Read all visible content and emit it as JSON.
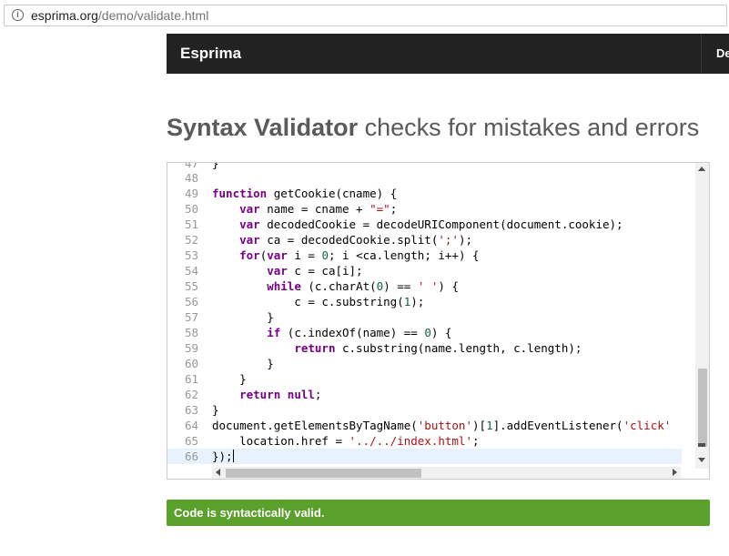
{
  "browser": {
    "url_host": "esprima.org",
    "url_path": "/demo/validate.html"
  },
  "navbar": {
    "brand": "Esprima",
    "link_partial": "De"
  },
  "heading": {
    "bold": "Syntax Validator",
    "rest": " checks for mistakes and errors"
  },
  "editor": {
    "partial_line_number": "47",
    "partial_line_code": "}",
    "line_numbers": [
      "48",
      "49",
      "50",
      "51",
      "52",
      "53",
      "54",
      "55",
      "56",
      "57",
      "58",
      "59",
      "60",
      "61",
      "62",
      "63",
      "64",
      "65",
      "66"
    ]
  },
  "status": {
    "message": "Code is syntactically valid.",
    "color": "#5aa12b"
  }
}
